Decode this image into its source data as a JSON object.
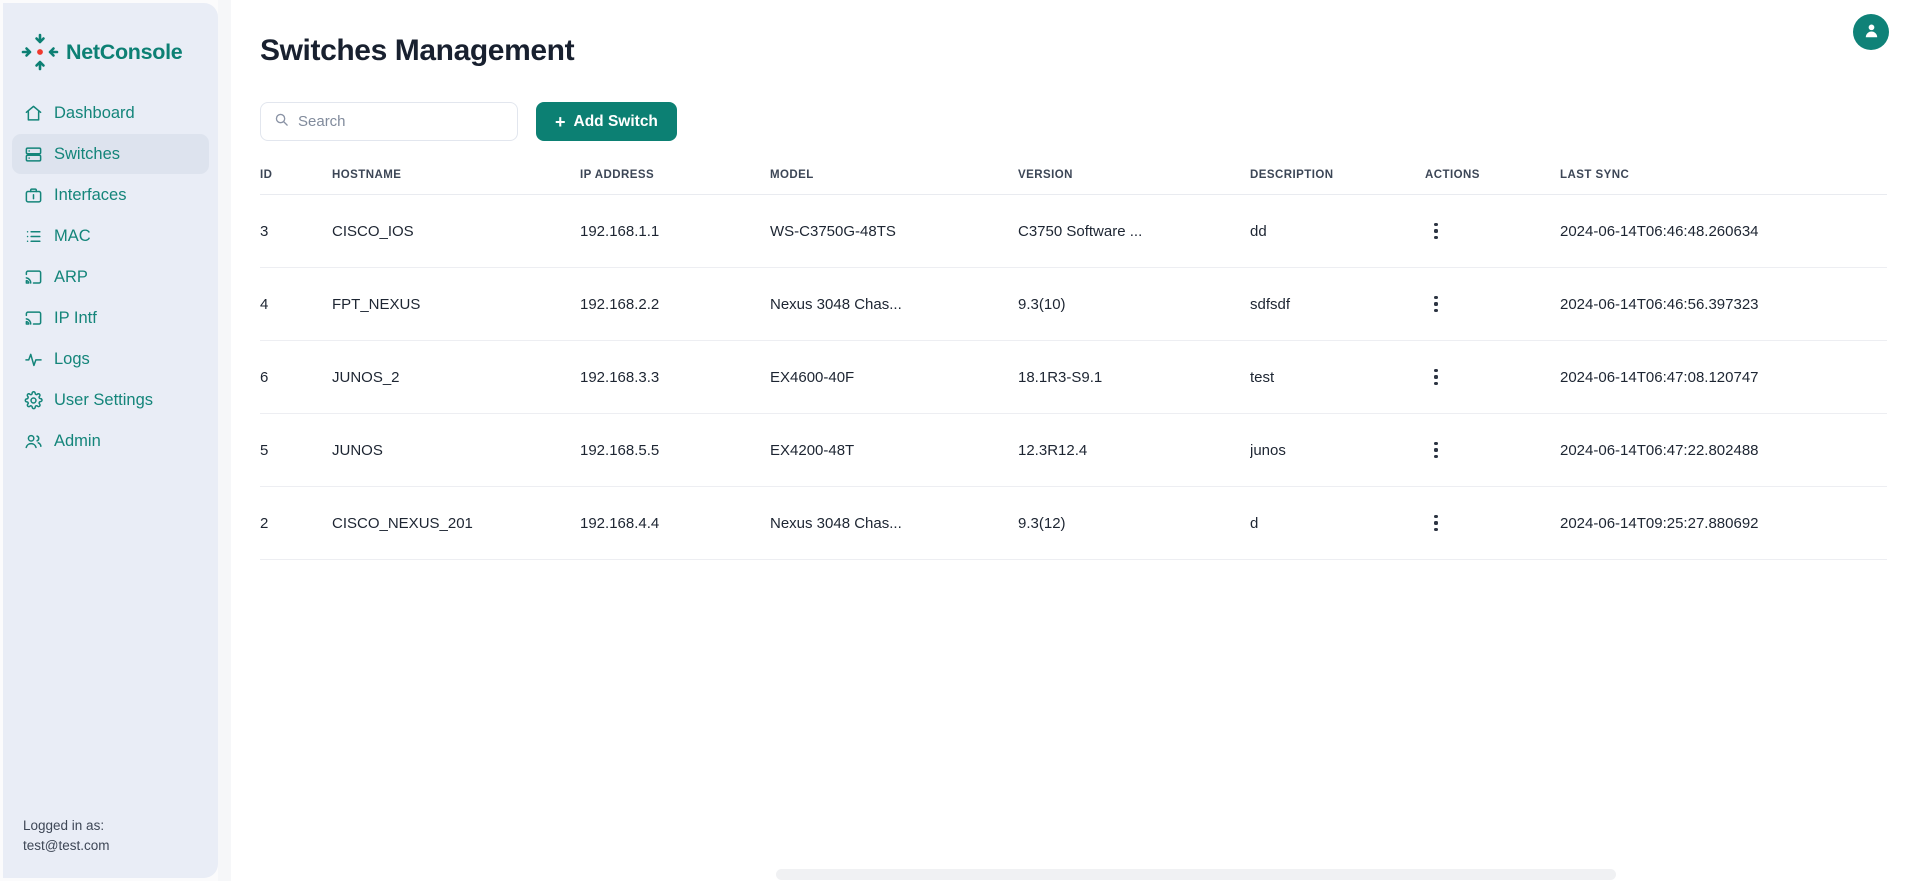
{
  "brand": {
    "name": "NetConsole",
    "logo_icon": "network-converge-icon",
    "accent": "#0d8074",
    "dot": "#f0392e"
  },
  "sidebar": {
    "items": [
      {
        "label": "Dashboard",
        "icon": "home-icon",
        "active": false
      },
      {
        "label": "Switches",
        "icon": "server-icon",
        "active": true
      },
      {
        "label": "Interfaces",
        "icon": "briefcase-icon",
        "active": false
      },
      {
        "label": "MAC",
        "icon": "list-icon",
        "active": false
      },
      {
        "label": "ARP",
        "icon": "cast-icon",
        "active": false
      },
      {
        "label": "IP Intf",
        "icon": "cast-icon",
        "active": false
      },
      {
        "label": "Logs",
        "icon": "activity-icon",
        "active": false
      },
      {
        "label": "User Settings",
        "icon": "gear-icon",
        "active": false
      },
      {
        "label": "Admin",
        "icon": "users-icon",
        "active": false
      }
    ],
    "footer": {
      "label": "Logged in as:",
      "email": "test@test.com"
    }
  },
  "header": {
    "title": "Switches Management",
    "avatar_icon": "user-avatar-icon"
  },
  "toolbar": {
    "search_placeholder": "Search",
    "search_value": "",
    "search_icon": "search-icon",
    "add_label": "Add Switch",
    "add_plus": "+",
    "add_color": "#0c8073"
  },
  "table": {
    "columns": [
      {
        "key": "id",
        "label": "ID"
      },
      {
        "key": "hostname",
        "label": "HOSTNAME"
      },
      {
        "key": "ip",
        "label": "IP ADDRESS"
      },
      {
        "key": "model",
        "label": "MODEL"
      },
      {
        "key": "version",
        "label": "VERSION"
      },
      {
        "key": "description",
        "label": "DESCRIPTION"
      },
      {
        "key": "actions",
        "label": "ACTIONS"
      },
      {
        "key": "last_sync",
        "label": "LAST SYNC"
      }
    ],
    "rows": [
      {
        "id": "3",
        "hostname": "CISCO_IOS",
        "ip": "192.168.1.1",
        "model": "WS-C3750G-48TS",
        "version": "C3750 Software ...",
        "description": "dd",
        "actions_icon": "kebab-menu-icon",
        "last_sync": "2024-06-14T06:46:48.260634"
      },
      {
        "id": "4",
        "hostname": "FPT_NEXUS",
        "ip": "192.168.2.2",
        "model": "Nexus 3048 Chas...",
        "version": "9.3(10)",
        "description": "sdfsdf",
        "actions_icon": "kebab-menu-icon",
        "last_sync": "2024-06-14T06:46:56.397323"
      },
      {
        "id": "6",
        "hostname": "JUNOS_2",
        "ip": "192.168.3.3",
        "model": "EX4600-40F",
        "version": "18.1R3-S9.1",
        "description": "test",
        "actions_icon": "kebab-menu-icon",
        "last_sync": "2024-06-14T06:47:08.120747"
      },
      {
        "id": "5",
        "hostname": "JUNOS",
        "ip": "192.168.5.5",
        "model": "EX4200-48T",
        "version": "12.3R12.4",
        "description": "junos",
        "actions_icon": "kebab-menu-icon",
        "last_sync": "2024-06-14T06:47:22.802488"
      },
      {
        "id": "2",
        "hostname": "CISCO_NEXUS_201",
        "ip": "192.168.4.4",
        "model": "Nexus 3048 Chas...",
        "version": "9.3(12)",
        "description": "d",
        "actions_icon": "kebab-menu-icon",
        "last_sync": "2024-06-14T09:25:27.880692"
      }
    ]
  }
}
